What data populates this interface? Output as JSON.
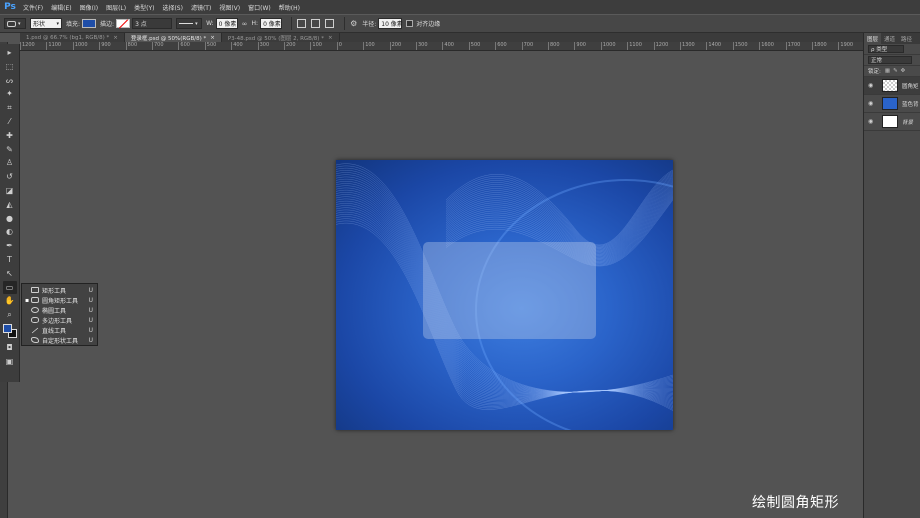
{
  "app": {
    "logo": "Ps"
  },
  "menu": [
    "文件(F)",
    "编辑(E)",
    "图像(I)",
    "图层(L)",
    "类型(Y)",
    "选择(S)",
    "滤镜(T)",
    "视图(V)",
    "窗口(W)",
    "帮助(H)"
  ],
  "options": {
    "mode": "形状",
    "fill_label": "填充:",
    "stroke_label": "描边:",
    "stroke_width": "3 点",
    "w_label": "W:",
    "w_value": "0 像素",
    "h_label": "H:",
    "h_value": "0 像素",
    "radius_label": "半径:",
    "radius_value": "10 像素",
    "align_edges": "对齐边缘",
    "fill_color": "#1f4ea8"
  },
  "tabs": [
    {
      "label": "1.psd @ 66.7% (bg1, RGB/8) *",
      "close": "×"
    },
    {
      "label": "登录框.psd @ 50%(RGB/8) *",
      "close": "×"
    },
    {
      "label": "P3-48.psd @ 50% (图层 2, RGB/8) *",
      "close": "×"
    }
  ],
  "ruler_ticks": [
    "1200",
    "1100",
    "1000",
    "900",
    "800",
    "700",
    "600",
    "500",
    "400",
    "300",
    "200",
    "100",
    "0",
    "100",
    "200",
    "300",
    "400",
    "500",
    "600",
    "700",
    "800",
    "900",
    "1000",
    "1100",
    "1200",
    "1300",
    "1400",
    "1500",
    "1600",
    "1700",
    "1800",
    "1900"
  ],
  "flyout": [
    {
      "label": "矩形工具",
      "key": "U",
      "icon": "rectangle-icon",
      "active": false
    },
    {
      "label": "圆角矩形工具",
      "key": "U",
      "icon": "rounded-rectangle-icon",
      "active": true
    },
    {
      "label": "椭圆工具",
      "key": "U",
      "icon": "ellipse-icon",
      "active": false
    },
    {
      "label": "多边形工具",
      "key": "U",
      "icon": "polygon-icon",
      "active": false
    },
    {
      "label": "直线工具",
      "key": "U",
      "icon": "line-icon",
      "active": false
    },
    {
      "label": "自定形状工具",
      "key": "U",
      "icon": "custom-shape-icon",
      "active": false
    }
  ],
  "panel": {
    "tabs": [
      "图层",
      "通道",
      "路径"
    ],
    "kind": "ρ 类型",
    "blend": "正常",
    "lock_label": "锁定:",
    "layers": [
      {
        "name": "圆角矩",
        "thumb": "#dcdcdc"
      },
      {
        "name": "蓝色背",
        "thumb": "#2a63c9"
      },
      {
        "name": "背景",
        "thumb": "#ffffff"
      }
    ]
  },
  "caption": "绘制圆角矩形"
}
